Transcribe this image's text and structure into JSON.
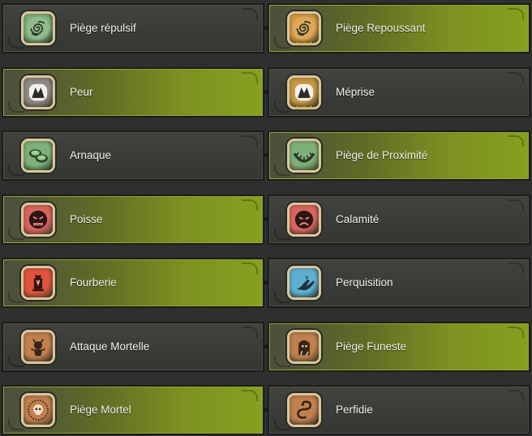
{
  "spells": [
    {
      "left": {
        "label": "Piège répulsif",
        "icon": "spiral-icon",
        "color": "#7fb07a",
        "selected": false
      },
      "right": {
        "label": "Piège Repoussant",
        "icon": "spiral-icon",
        "color": "#d9993f",
        "selected": true,
        "stars": "★★★"
      }
    },
    {
      "left": {
        "label": "Peur",
        "icon": "fear-mask-icon",
        "color": "#8d8a86",
        "selected": true
      },
      "right": {
        "label": "Méprise",
        "icon": "fear-mask-icon",
        "color": "#c79843",
        "selected": false,
        "stars": "★★★"
      }
    },
    {
      "left": {
        "label": "Arnaque",
        "icon": "coins-icon",
        "color": "#7fb07a",
        "selected": false
      },
      "right": {
        "label": "Piège de Proximité",
        "icon": "trap-ring-icon",
        "color": "#7fb07a",
        "selected": true
      }
    },
    {
      "left": {
        "label": "Poisse",
        "icon": "cursed-face-icon",
        "color": "#d9665f",
        "selected": true
      },
      "right": {
        "label": "Calamité",
        "icon": "sad-face-icon",
        "color": "#d9665f",
        "selected": false
      }
    },
    {
      "left": {
        "label": "Fourberie",
        "icon": "lantern-icon",
        "color": "#e0553e",
        "selected": true
      },
      "right": {
        "label": "Perquisition",
        "icon": "grab-hand-icon",
        "color": "#5fb0d0",
        "selected": false
      }
    },
    {
      "left": {
        "label": "Attaque Mortelle",
        "icon": "demon-icon",
        "color": "#c0804f",
        "selected": false
      },
      "right": {
        "label": "Piège Funeste",
        "icon": "tombstone-icon",
        "color": "#c0804f",
        "selected": true
      }
    },
    {
      "left": {
        "label": "Piège Mortel",
        "icon": "skull-burst-icon",
        "color": "#c0804f",
        "selected": true
      },
      "right": {
        "label": "Perfidie",
        "icon": "serpent-icon",
        "color": "#c0804f",
        "selected": false
      }
    }
  ]
}
